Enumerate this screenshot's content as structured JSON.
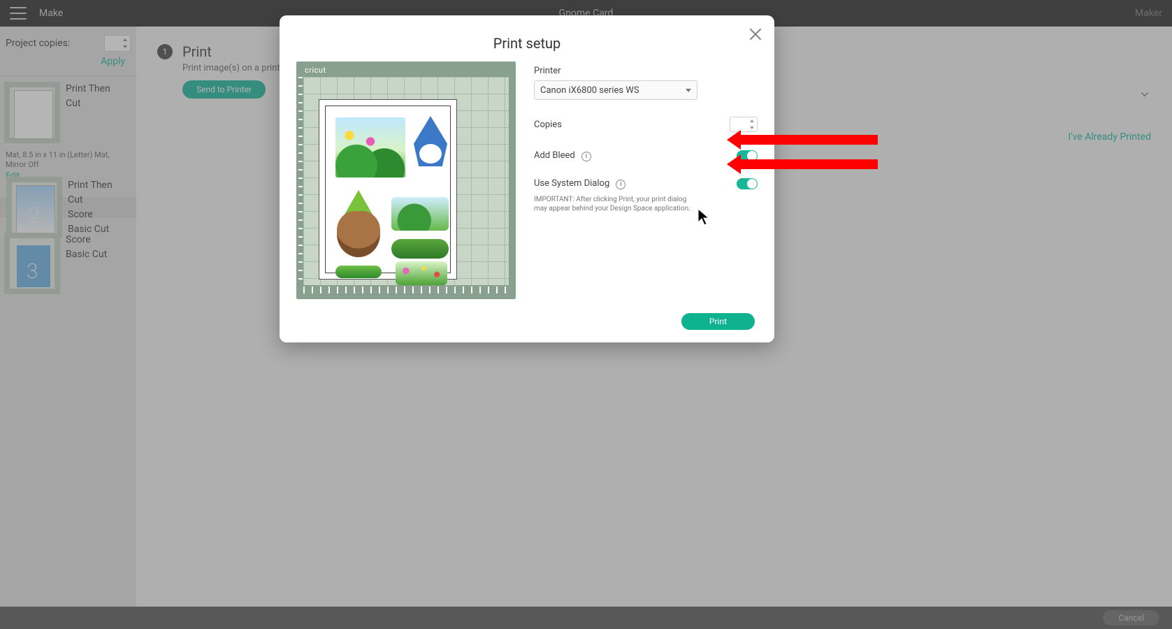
{
  "topbar": {
    "make": "Make",
    "project": "Gnome Card",
    "maker": "Maker"
  },
  "left": {
    "project_copies": "Project copies:",
    "apply": "Apply",
    "mat_desc": "Mat, 8.5 in x 11 in (Letter) Mat, Mirror Off",
    "edit": "Edit",
    "item1_l1": "Print Then",
    "item1_l2": "Cut",
    "item2_l1": "Print Then",
    "item2_l2": "Cut",
    "item2_l3": "Score",
    "item2_l4": "Basic Cut",
    "item3_l1": "Score",
    "item3_l2": "Basic Cut"
  },
  "step": {
    "num": "1",
    "title": "Print",
    "sub": "Print image(s) on a printer of",
    "send": "Send to Printer",
    "already": "I've Already Printed"
  },
  "modal": {
    "title": "Print setup",
    "brand": "cricut",
    "printer_label": "Printer",
    "printer_value": "Canon iX6800 series WS",
    "copies_label": "Copies",
    "bleed_label": "Add Bleed",
    "dialog_label": "Use System Dialog",
    "important": "IMPORTANT: After clicking Print, your print dialog may appear behind your Design Space application.",
    "print": "Print"
  },
  "bottom": {
    "cancel": "Cancel"
  }
}
